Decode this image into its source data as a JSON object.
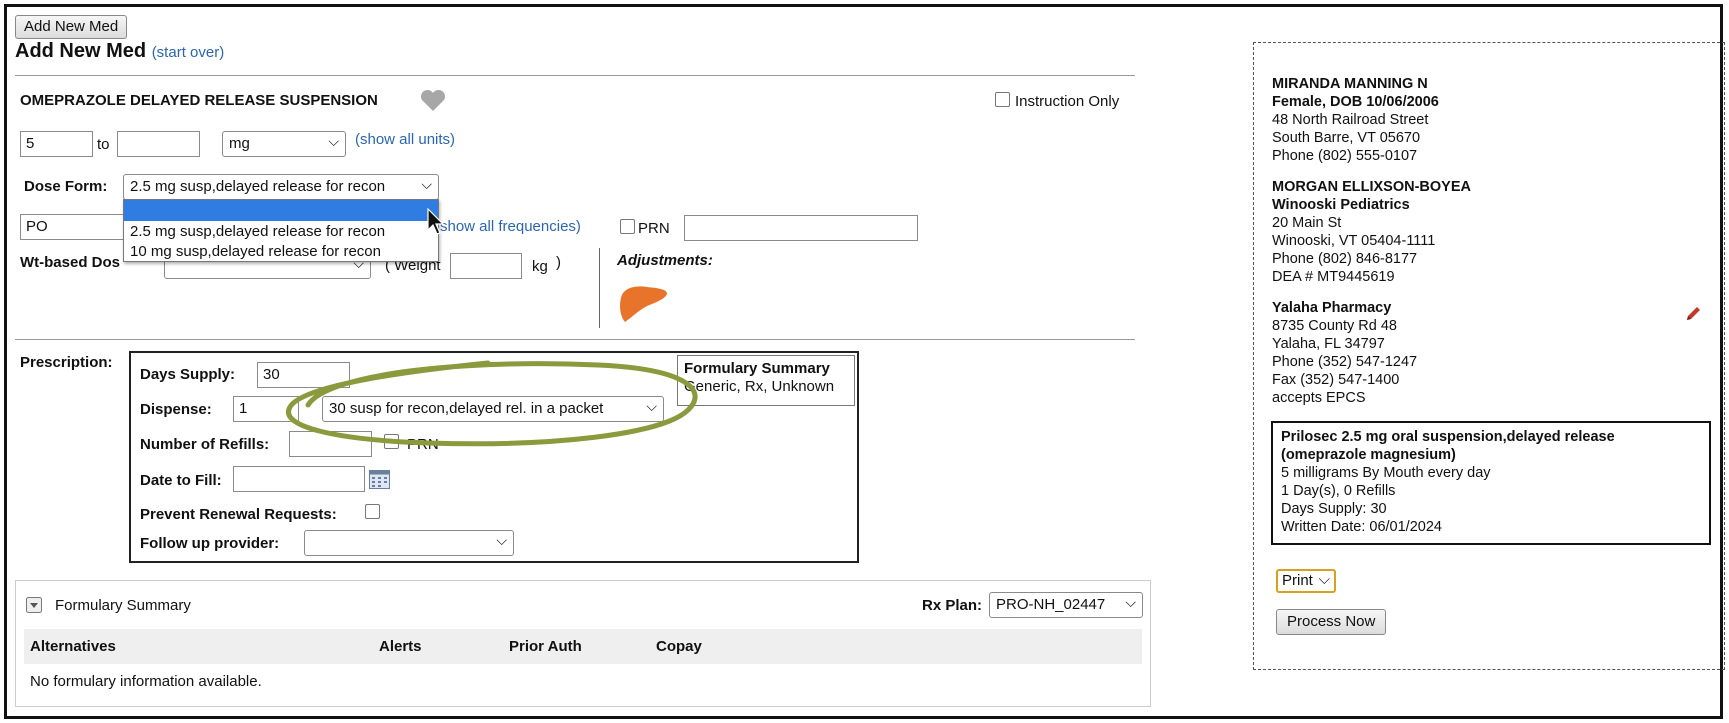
{
  "top_button": "Add New Med",
  "page_title": "Add New Med",
  "start_over": "(start over)",
  "med_name": "OMEPRAZOLE DELAYED RELEASE SUSPENSION",
  "instruction_only": "Instruction Only",
  "dose": {
    "from": "5",
    "to_label": "to",
    "to_value": "",
    "unit": "mg",
    "show_all_units": "(show all units)"
  },
  "dose_form": {
    "label": "Dose Form:",
    "selected": "2.5 mg susp,delayed release for recon",
    "options": [
      "2.5 mg susp,delayed release for recon",
      "10 mg susp,delayed release for recon"
    ]
  },
  "route": {
    "value": "PO",
    "show_all_frequencies": "show all frequencies)",
    "prn_label": "PRN",
    "prn_text": ""
  },
  "wt_based": {
    "label": "Wt-based Dos",
    "weight_label": "( Weight",
    "weight_unit": "kg",
    "close_paren": ")"
  },
  "adjustments_label": "Adjustments:",
  "prescription": {
    "label": "Prescription:",
    "days_supply_label": "Days Supply:",
    "days_supply": "30",
    "dispense_label": "Dispense:",
    "dispense_qty": "1",
    "dispense_unit": "30 susp for recon,delayed rel. in a packet",
    "refills_label": "Number of Refills:",
    "refills_value": "",
    "refills_prn": "PRN",
    "date_to_fill_label": "Date to Fill:",
    "date_to_fill": "",
    "prevent_renewal_label": "Prevent Renewal Requests:",
    "follow_up_label": "Follow up provider:",
    "follow_up_value": ""
  },
  "formulary_box": {
    "title": "Formulary Summary",
    "value": "Generic, Rx, Unknown"
  },
  "formulary_section": {
    "title": "Formulary Summary",
    "rx_plan_label": "Rx Plan:",
    "rx_plan_value": "PRO-NH_02447",
    "columns": [
      "Alternatives",
      "Alerts",
      "Prior Auth",
      "Copay"
    ],
    "empty_message": "No formulary information available."
  },
  "patient": {
    "name": "MIRANDA MANNING N",
    "sex_dob": "Female, DOB 10/06/2006",
    "address1": "48 North Railroad Street",
    "address2": "South Barre, VT 05670",
    "phone": "Phone (802) 555-0107"
  },
  "prescriber": {
    "name": "MORGAN ELLIXSON-BOYEA",
    "practice": "Winooski Pediatrics",
    "address1": "20 Main St",
    "address2": "Winooski, VT 05404-1111",
    "phone": "Phone (802) 846-8177",
    "dea": "DEA # MT9445619"
  },
  "pharmacy": {
    "name": "Yalaha Pharmacy",
    "address1": "8735 County Rd 48",
    "address2": "Yalaha, FL 34797",
    "phone": "Phone (352) 547-1247",
    "fax": "Fax (352) 547-1400",
    "note": "accepts EPCS"
  },
  "rx_summary": {
    "line1": "Prilosec 2.5 mg oral suspension,delayed release",
    "line2": "(omeprazole magnesium)",
    "line3": "5 milligrams By Mouth every day",
    "line4": "1 Day(s), 0 Refills",
    "line5": "Days Supply: 30",
    "line6": "Written Date: 06/01/2024"
  },
  "print_select": "Print",
  "process_now": "Process Now",
  "colors": {
    "link": "#2a66b3",
    "highlight_ellipse": "#8a9a3c",
    "liver": "#e8732a",
    "dropdown_selected": "#2f7de1",
    "print_border": "#d9a020",
    "pencil": "#c0392b"
  }
}
